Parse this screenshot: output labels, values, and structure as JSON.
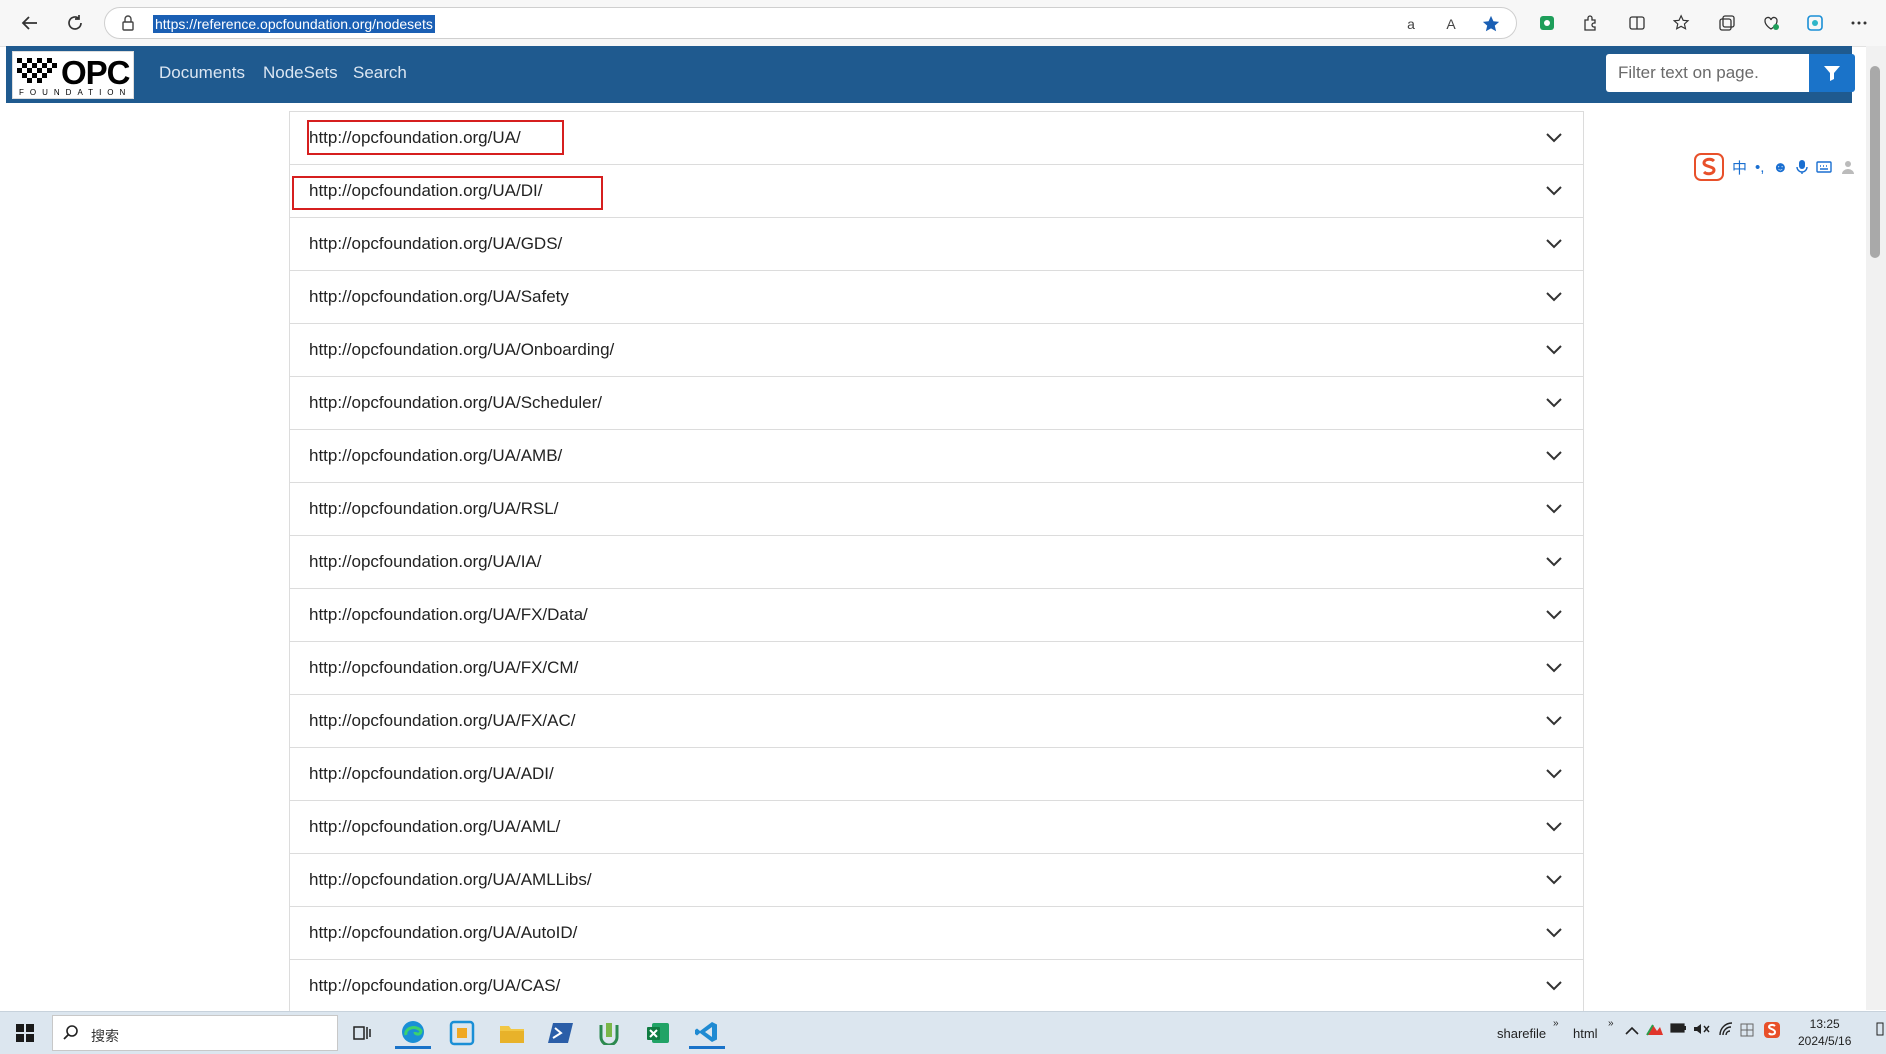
{
  "browser": {
    "url": "https://reference.opcfoundation.org/nodesets"
  },
  "site": {
    "logo_main": "OPC",
    "logo_sub": "FOUNDATION",
    "nav": [
      "Documents",
      "NodeSets",
      "Search"
    ],
    "filter_placeholder": "Filter text on page."
  },
  "nodesets": [
    "http://opcfoundation.org/UA/",
    "http://opcfoundation.org/UA/DI/",
    "http://opcfoundation.org/UA/GDS/",
    "http://opcfoundation.org/UA/Safety",
    "http://opcfoundation.org/UA/Onboarding/",
    "http://opcfoundation.org/UA/Scheduler/",
    "http://opcfoundation.org/UA/AMB/",
    "http://opcfoundation.org/UA/RSL/",
    "http://opcfoundation.org/UA/IA/",
    "http://opcfoundation.org/UA/FX/Data/",
    "http://opcfoundation.org/UA/FX/CM/",
    "http://opcfoundation.org/UA/FX/AC/",
    "http://opcfoundation.org/UA/ADI/",
    "http://opcfoundation.org/UA/AML/",
    "http://opcfoundation.org/UA/AMLLibs/",
    "http://opcfoundation.org/UA/AutoID/",
    "http://opcfoundation.org/UA/CAS/"
  ],
  "ime": {
    "lang": "中"
  },
  "taskbar": {
    "search_label": "搜索",
    "item_sharefile": "sharefile",
    "item_html": "html",
    "time": "13:25",
    "date": "2024/5/16"
  },
  "colors": {
    "header_bg": "#1f5a8f",
    "filter_button": "#1a73c9",
    "highlight_box": "#d61f1f",
    "url_selection": "#1a5fb4"
  }
}
